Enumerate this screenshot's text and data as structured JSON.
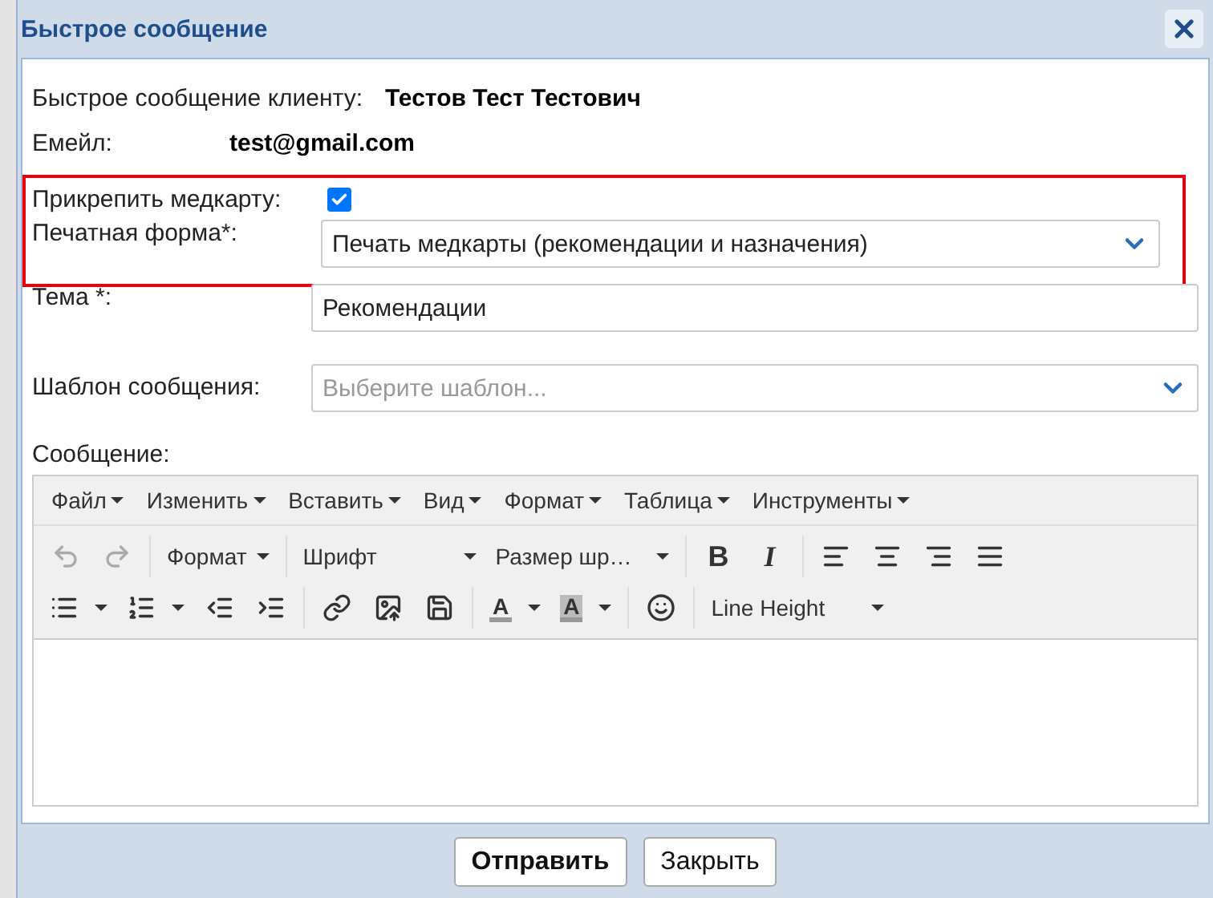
{
  "dialog": {
    "title": "Быстрое сообщение"
  },
  "info": [
    {
      "label": "Быстрое сообщение клиенту:",
      "value": "Тестов Тест Тестович"
    },
    {
      "label": "Емейл:",
      "value": "test@gmail.com"
    }
  ],
  "highlighted_group": {
    "attach": {
      "label": "Прикрепить медкарту:",
      "checked": true
    },
    "print_form": {
      "label": "Печатная форма*:",
      "value": "Печать медкарты (рекомендации и назначения)"
    }
  },
  "subject": {
    "label": "Тема *:",
    "value": "Рекомендации"
  },
  "template": {
    "label": "Шаблон сообщения:",
    "placeholder": "Выберите шаблон..."
  },
  "message": {
    "label": "Сообщение:",
    "menu": [
      "Файл",
      "Изменить",
      "Вставить",
      "Вид",
      "Формат",
      "Таблица",
      "Инструменты"
    ],
    "toolbar_rows": [
      [
        {
          "kind": "undo",
          "disabled": true
        },
        {
          "kind": "redo",
          "disabled": true
        },
        {
          "kind": "separator"
        },
        {
          "kind": "dropdown",
          "label": "Формат",
          "disabled": false
        },
        {
          "kind": "separator"
        },
        {
          "kind": "wide-dropdown",
          "label": "Шрифт",
          "disabled": false
        },
        {
          "kind": "wide-dropdown",
          "label": "Размер шр…",
          "disabled": false
        },
        {
          "kind": "separator"
        },
        {
          "kind": "bold",
          "label": "B",
          "disabled": false
        },
        {
          "kind": "italic",
          "label": "I",
          "disabled": false
        },
        {
          "kind": "separator"
        },
        {
          "kind": "align-left",
          "disabled": false
        },
        {
          "kind": "align-center",
          "disabled": false
        },
        {
          "kind": "align-right",
          "disabled": false
        },
        {
          "kind": "align-justify",
          "disabled": false
        }
      ],
      [
        {
          "kind": "bullets",
          "disabled": false
        },
        {
          "kind": "numbers",
          "disabled": false
        },
        {
          "kind": "outdent",
          "disabled": false
        },
        {
          "kind": "indent",
          "disabled": false
        },
        {
          "kind": "separator"
        },
        {
          "kind": "link",
          "disabled": false
        },
        {
          "kind": "upload",
          "disabled": false
        },
        {
          "kind": "save",
          "disabled": false
        },
        {
          "kind": "separator"
        },
        {
          "kind": "text-color",
          "label": "A",
          "disabled": false
        },
        {
          "kind": "highlight-color",
          "label": "A",
          "disabled": false
        },
        {
          "kind": "separator"
        },
        {
          "kind": "smile",
          "disabled": false
        },
        {
          "kind": "separator"
        },
        {
          "kind": "wide-dropdown",
          "label": "Line Height",
          "disabled": false
        }
      ]
    ]
  },
  "buttons": [
    {
      "label": "Отправить",
      "primary": true
    },
    {
      "label": "Закрыть",
      "primary": false
    }
  ]
}
